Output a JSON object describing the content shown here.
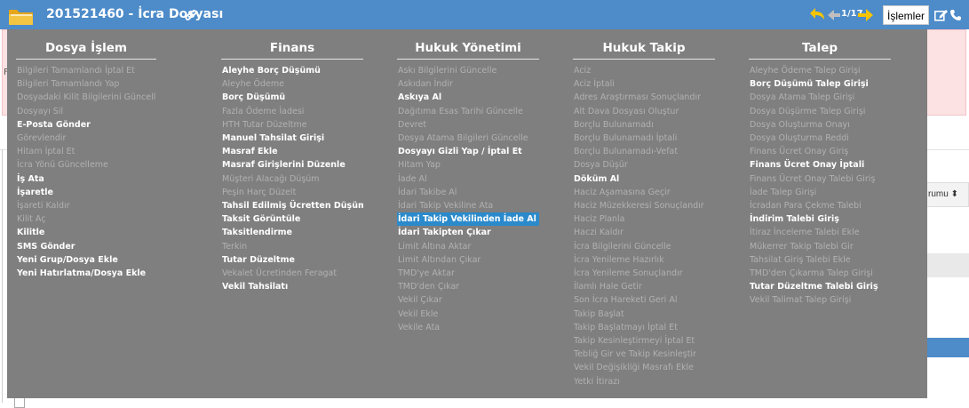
{
  "header": {
    "title": "201521460 - İcra Dosyası",
    "nav_count": "1/17",
    "actions_label": "İşlemler",
    "icons": [
      "folder-icon",
      "link-icon",
      "arrow-back-icon",
      "arrow-forward-icon",
      "edit-icon",
      "phone-icon"
    ],
    "accent_color": "#4d8bc9"
  },
  "background": {
    "partial_letter": "F",
    "column_header": "rumu"
  },
  "menu": {
    "columns": [
      {
        "heading": "Dosya İşlem",
        "items": [
          {
            "label": "Bilgileri Tamamlandı İptal Et",
            "enabled": false
          },
          {
            "label": "Bilgileri Tamamlandı Yap",
            "enabled": false
          },
          {
            "label": "Dosyadaki Kilit Bilgilerini Güncelle",
            "enabled": false
          },
          {
            "label": "Dosyayı Sil",
            "enabled": false
          },
          {
            "label": "E-Posta Gönder",
            "enabled": true
          },
          {
            "label": "Görevlendir",
            "enabled": false
          },
          {
            "label": "Hitam İptal Et",
            "enabled": false
          },
          {
            "label": "İcra Yönü Güncelleme",
            "enabled": false
          },
          {
            "label": "İş Ata",
            "enabled": true
          },
          {
            "label": "İşaretle",
            "enabled": true
          },
          {
            "label": "İşareti Kaldır",
            "enabled": false
          },
          {
            "label": "Kilit Aç",
            "enabled": false
          },
          {
            "label": "Kilitle",
            "enabled": true
          },
          {
            "label": "SMS Gönder",
            "enabled": true
          },
          {
            "label": "Yeni Grup/Dosya Ekle",
            "enabled": true
          },
          {
            "label": "Yeni Hatırlatma/Dosya Ekle",
            "enabled": true
          }
        ]
      },
      {
        "heading": "Finans",
        "items": [
          {
            "label": "Aleyhe Borç Düşümü",
            "enabled": true
          },
          {
            "label": "Aleyhe Ödeme",
            "enabled": false
          },
          {
            "label": "Borç Düşümü",
            "enabled": true
          },
          {
            "label": "Fazla Ödeme İadesi",
            "enabled": false
          },
          {
            "label": "HTH Tutar Düzeltme",
            "enabled": false
          },
          {
            "label": "Manuel Tahsilat Girişi",
            "enabled": true
          },
          {
            "label": "Masraf Ekle",
            "enabled": true
          },
          {
            "label": "Masraf Girişlerini Düzenle",
            "enabled": true
          },
          {
            "label": "Müşteri Alacağı Düşüm",
            "enabled": false
          },
          {
            "label": "Peşin Harç Düzelt",
            "enabled": false
          },
          {
            "label": "Tahsil Edilmiş Ücretten Düşüm",
            "enabled": true
          },
          {
            "label": "Taksit Görüntüle",
            "enabled": true
          },
          {
            "label": "Taksitlendirme",
            "enabled": true
          },
          {
            "label": "Terkin",
            "enabled": false
          },
          {
            "label": "Tutar Düzeltme",
            "enabled": true
          },
          {
            "label": "Vekalet Ücretinden Feragat",
            "enabled": false
          },
          {
            "label": "Vekil Tahsilatı",
            "enabled": true
          }
        ]
      },
      {
        "heading": "Hukuk Yönetimi",
        "items": [
          {
            "label": "Askı Bilgilerini Güncelle",
            "enabled": false
          },
          {
            "label": "Askıdan İndir",
            "enabled": false
          },
          {
            "label": "Askıya Al",
            "enabled": true
          },
          {
            "label": "Dağıtıma Esas Tarihi Güncelle",
            "enabled": false
          },
          {
            "label": "Devret",
            "enabled": false
          },
          {
            "label": "Dosya Atama Bilgileri Güncelle",
            "enabled": false
          },
          {
            "label": "Dosyayı Gizli Yap / İptal Et",
            "enabled": true
          },
          {
            "label": "Hitam Yap",
            "enabled": false
          },
          {
            "label": "İade Al",
            "enabled": false
          },
          {
            "label": "İdari Takibe Al",
            "enabled": false
          },
          {
            "label": "İdari Takip Vekiline Ata",
            "enabled": false
          },
          {
            "label": "İdari Takip Vekilinden İade Al",
            "enabled": true,
            "highlighted": true
          },
          {
            "label": "İdari Takipten Çıkar",
            "enabled": true
          },
          {
            "label": "Limit Altına Aktar",
            "enabled": false
          },
          {
            "label": "Limit Altından Çıkar",
            "enabled": false
          },
          {
            "label": "TMD'ye Aktar",
            "enabled": false
          },
          {
            "label": "TMD'den Çıkar",
            "enabled": false
          },
          {
            "label": "Vekil Çıkar",
            "enabled": false
          },
          {
            "label": "Vekil Ekle",
            "enabled": false
          },
          {
            "label": "Vekile Ata",
            "enabled": false
          }
        ]
      },
      {
        "heading": "Hukuk Takip",
        "items": [
          {
            "label": "Aciz",
            "enabled": false
          },
          {
            "label": "Aciz İptali",
            "enabled": false
          },
          {
            "label": "Adres Araştırması Sonuçlandır",
            "enabled": false
          },
          {
            "label": "Alt Dava Dosyası Oluştur",
            "enabled": false
          },
          {
            "label": "Borçlu Bulunamadı",
            "enabled": false
          },
          {
            "label": "Borçlu Bulunamadı İptali",
            "enabled": false
          },
          {
            "label": "Borçlu Bulunamadı-Vefat",
            "enabled": false
          },
          {
            "label": "Dosya Düşür",
            "enabled": false
          },
          {
            "label": "Döküm Al",
            "enabled": true
          },
          {
            "label": "Haciz Aşamasına Geçir",
            "enabled": false
          },
          {
            "label": "Haciz Müzekkeresi Sonuçlandır",
            "enabled": false
          },
          {
            "label": "Haciz Planla",
            "enabled": false
          },
          {
            "label": "Haczi Kaldır",
            "enabled": false
          },
          {
            "label": "İcra Bilgilerini Güncelle",
            "enabled": false
          },
          {
            "label": "İcra Yenileme Hazırlık",
            "enabled": false
          },
          {
            "label": "İcra Yenileme Sonuçlandır",
            "enabled": false
          },
          {
            "label": "İlamlı Hale Getir",
            "enabled": false
          },
          {
            "label": "Son İcra Hareketi Geri Al",
            "enabled": false
          },
          {
            "label": "Takip Başlat",
            "enabled": false
          },
          {
            "label": "Takip Başlatmayı İptal Et",
            "enabled": false
          },
          {
            "label": "Takip Kesinleştirmeyi İptal Et",
            "enabled": false
          },
          {
            "label": "Tebliğ Gir ve Takip Kesinleştir",
            "enabled": false
          },
          {
            "label": "Vekil Değişikliği Masrafı Ekle",
            "enabled": false
          },
          {
            "label": "Yetki İtirazı",
            "enabled": false
          }
        ]
      },
      {
        "heading": "Talep",
        "items": [
          {
            "label": "Aleyhe Ödeme Talep Girişi",
            "enabled": false
          },
          {
            "label": "Borç Düşümü Talep Girişi",
            "enabled": true
          },
          {
            "label": "Dosya Atama Talep Girişi",
            "enabled": false
          },
          {
            "label": "Dosya Düşürme Talep Girişi",
            "enabled": false
          },
          {
            "label": "Dosya Oluşturma Onayı",
            "enabled": false
          },
          {
            "label": "Dosya Oluşturma Reddi",
            "enabled": false
          },
          {
            "label": "Finans Ücret Onay Giriş",
            "enabled": false
          },
          {
            "label": "Finans Ücret Onay İptali",
            "enabled": true
          },
          {
            "label": "Finans Ücret Onay Talebi Giriş",
            "enabled": false
          },
          {
            "label": "İade Talep Girişi",
            "enabled": false
          },
          {
            "label": "İcradan Para Çekme Talebi",
            "enabled": false
          },
          {
            "label": "İndirim Talebi Giriş",
            "enabled": true
          },
          {
            "label": "İtiraz İnceleme Talebi Ekle",
            "enabled": false
          },
          {
            "label": "Mükerrer Takip Talebi Gir",
            "enabled": false
          },
          {
            "label": "Tahsilat Giriş Talebi Ekle",
            "enabled": false
          },
          {
            "label": "TMD'den Çıkarma Talep Girişi",
            "enabled": false
          },
          {
            "label": "Tutar Düzeltme Talebi Giriş",
            "enabled": true
          },
          {
            "label": "Vekil Talimat Talep Girişi",
            "enabled": false
          }
        ]
      }
    ]
  }
}
